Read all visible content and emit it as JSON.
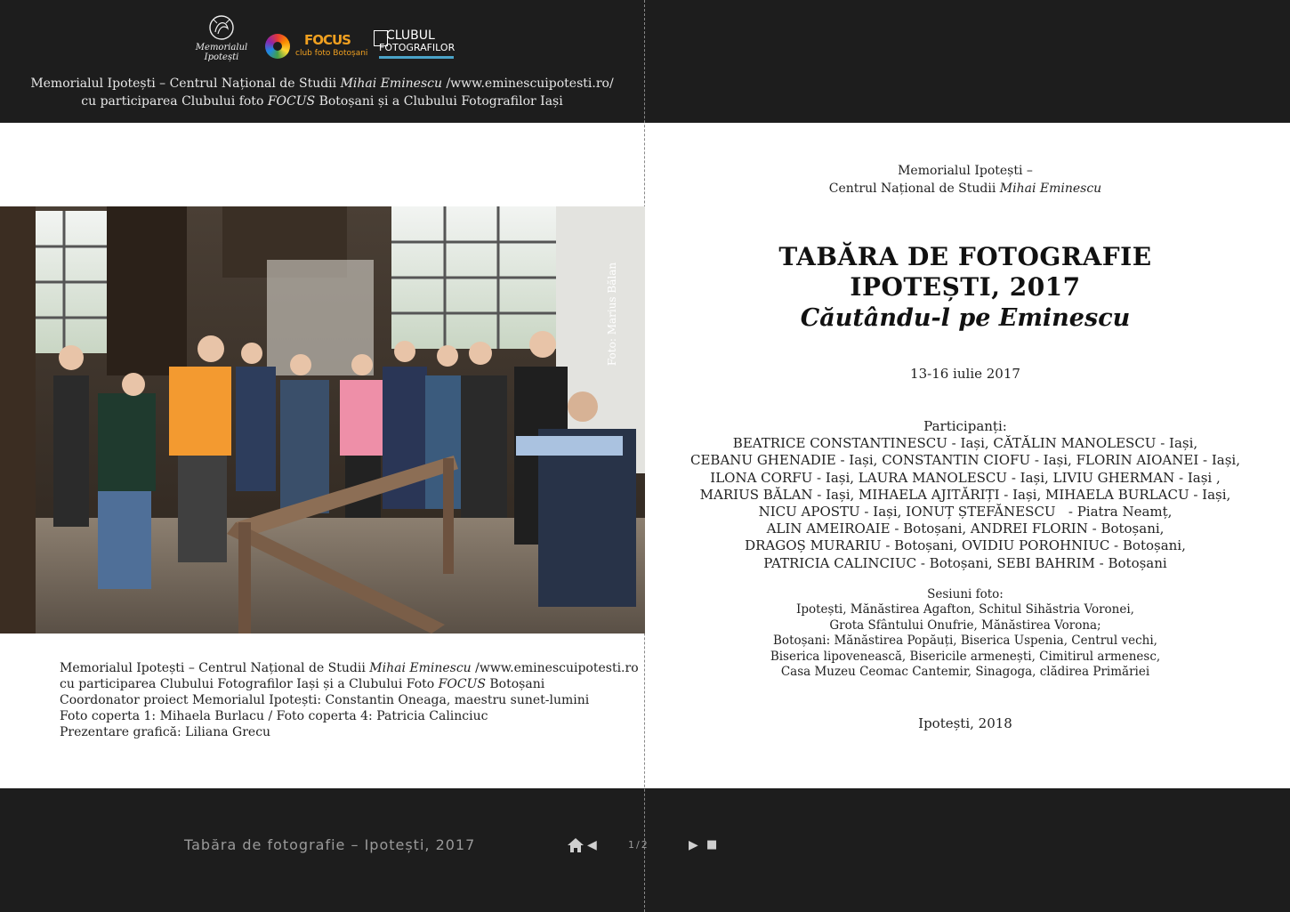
{
  "logos": {
    "memorial_text_1": "Memorialul",
    "memorial_text_2": "Ipotești",
    "focus_word": "FOCUS",
    "focus_sub": "club foto Botoșani",
    "club_line_1": "CLUBUL",
    "club_line_2": "FOTOGRAFILOR"
  },
  "back_cover": {
    "top_line_1_a": "Memorialul Ipotești – Centrul Național de Studii ",
    "top_line_1_italic": "Mihai Eminescu",
    "top_line_1_b": " /www.eminescuipotesti.ro/",
    "top_line_2_a": "cu participarea Clubului foto ",
    "top_line_2_italic": "FOCUS",
    "top_line_2_b": " Botoșani și a Clubului Fotografilor Iași",
    "photo_credit": "Foto: Marius Bălan",
    "credit_1_a": "Memorialul Ipotești – Centrul Național de Studii ",
    "credit_1_italic": "Mihai Eminescu",
    "credit_1_b": " /www.eminescuipotesti.ro",
    "credit_2_a": "cu participarea Clubului Fotografilor Iași și a Clubului Foto ",
    "credit_2_italic": "FOCUS",
    "credit_2_b": " Botoșani",
    "credit_3": "Coordonator proiect Memorialul Ipotești: Constantin Oneaga, maestru sunet-lumini",
    "credit_4": "Foto coperta 1: Mihaela Burlacu / Foto coperta 4: Patricia Calinciuc",
    "credit_5": "Prezentare grafică: Liliana Grecu"
  },
  "title_page": {
    "inst_line_1": "Memorialul Ipotești –",
    "inst_line_2_a": "Centrul Național de Studii ",
    "inst_line_2_italic": "Mihai Eminescu",
    "title_line_1": "TABĂRA DE FOTOGRAFIE",
    "title_line_2": "IPOTEȘTI, 2017",
    "subtitle": "Căutându-l pe Eminescu",
    "dates": "13-16 iulie 2017",
    "participants_heading": "Participanți:",
    "participants": [
      "BEATRICE CONSTANTINESCU - Iași, CĂTĂLIN MANOLESCU - Iași,",
      "CEBANU GHENADIE - Iași, CONSTANTIN CIOFU - Iași, FLORIN AIOANEI - Iași,",
      "ILONA CORFU - Iași, LAURA MANOLESCU - Iași, LIVIU GHERMAN - Iași ,",
      "MARIUS BĂLAN - Iași, MIHAELA AJITĂRIȚI - Iași, MIHAELA BURLACU - Iași,",
      "NICU APOSTU - Iași, IONUȚ ȘTEFĂNESCU   - Piatra Neamț,",
      "ALIN AMEIROAIE - Botoșani, ANDREI FLORIN - Botoșani,",
      "DRAGOȘ MURARIU - Botoșani, OVIDIU POROHNIUC - Botoșani,",
      "PATRICIA CALINCIUC - Botoșani, SEBI BAHRIM - Botoșani"
    ],
    "sessions_heading": "Sesiuni foto:",
    "sessions": [
      "Ipotești, Mănăstirea Agafton, Schitul Sihăstria Voronei,",
      "Grota Sfântului Onufrie, Mănăstirea Vorona;",
      "Botoșani: Mănăstirea Popăuți, Biserica Uspenia, Centrul vechi,",
      "Biserica lipovenească, Bisericile armenești, Cimitirul armenesc,",
      "Casa Muzeu Ceomac Cantemir, Sinagoga, clădirea Primăriei"
    ],
    "place_year": "Ipotești, 2018"
  },
  "footer": {
    "title": "Tabăra de fotografie – Ipotești, 2017",
    "page_indicator": "1/2",
    "prev_glyph": "◀",
    "next_glyph": "▶",
    "last_glyph": "■"
  }
}
